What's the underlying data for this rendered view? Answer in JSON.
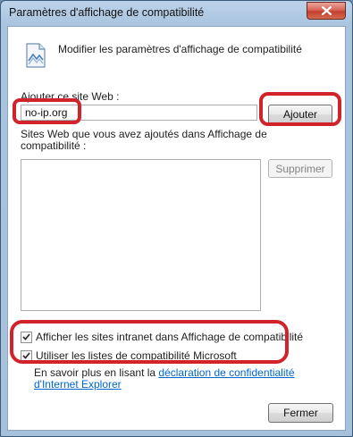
{
  "window": {
    "title": "Paramètres d'affichage de compatibilité"
  },
  "header": {
    "text": "Modifier les paramètres d'affichage de compatibilité",
    "icon": "compatibility-view-icon"
  },
  "add_site": {
    "label": "Ajouter ce site Web :",
    "value": "no-ip.org",
    "button": "Ajouter"
  },
  "site_list": {
    "label": "Sites Web que vous avez ajoutés dans Affichage de compatibilité :",
    "items": [],
    "remove_button": "Supprimer"
  },
  "options": {
    "intranet": {
      "label": "Afficher les sites intranet dans Affichage de compatibilité",
      "checked": true
    },
    "microsoft_lists": {
      "label": "Utiliser les listes de compatibilité Microsoft",
      "checked": true
    }
  },
  "info": {
    "prefix": "En savoir plus en lisant la ",
    "link": "déclaration de confidentialité d'Internet Explorer"
  },
  "footer": {
    "close_button": "Fermer"
  },
  "colors": {
    "annotation": "#d2232a",
    "link": "#0066cc"
  }
}
